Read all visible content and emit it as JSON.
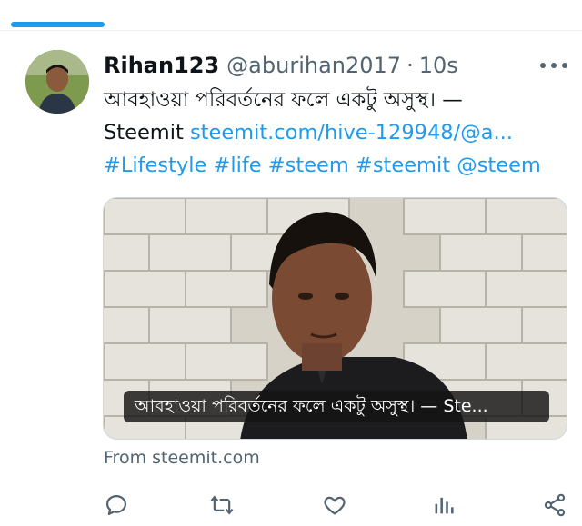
{
  "tweet": {
    "author_name": "Rihan123",
    "author_handle": "@aburihan2017",
    "separator": "·",
    "time": "10s",
    "text_line1": "আবহাওয়া পরিবর্তনের ফলে একটু অসুস্থ। —",
    "text_line2_prefix": "Steemit",
    "link": "steemit.com/hive-129948/@a...",
    "hashtags": [
      "#Lifestyle",
      "#life",
      "#steem",
      "#steemit",
      "@steem"
    ],
    "card_caption": "আবহাওয়া পরিবর্তনের ফলে একটু অসুস্থ। — Ste...",
    "source": "From steemit.com"
  },
  "icons": {
    "more": "more-horizontal-icon",
    "reply": "reply-icon",
    "retweet": "retweet-icon",
    "like": "heart-icon",
    "views": "views-icon",
    "share": "share-icon"
  },
  "colors": {
    "accent": "#1d9bf0",
    "secondary_text": "#536471",
    "primary_text": "#0f1419",
    "border": "#cfd9de"
  }
}
